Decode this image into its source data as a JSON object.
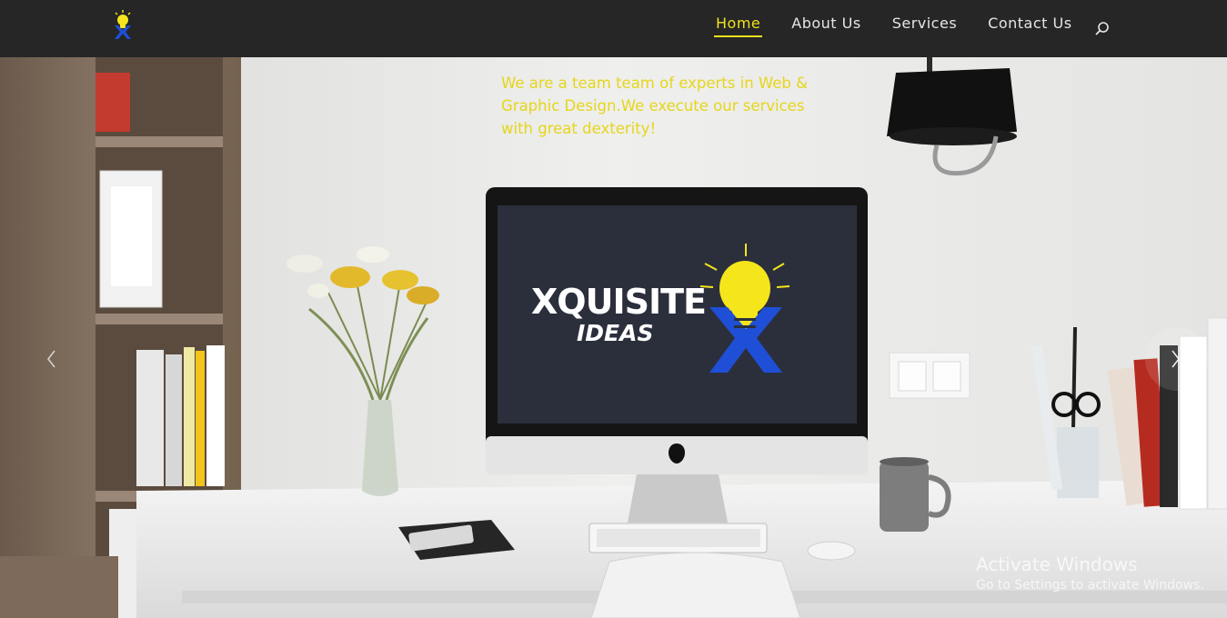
{
  "header": {
    "logo_icon": "lightbulb-x-logo-icon",
    "nav": [
      {
        "label": "Home",
        "active": true
      },
      {
        "label": "About Us",
        "active": false
      },
      {
        "label": "Services",
        "active": false
      },
      {
        "label": "Contact Us",
        "active": false
      }
    ],
    "search_icon": "search-icon"
  },
  "hero": {
    "tagline": "We are a team team of experts in Web & Graphic Design.We execute our services with great dexterity!",
    "brand_line1": "XQUISITE",
    "brand_line2": "IDEAS",
    "prev_icon": "chevron-left-icon",
    "next_icon": "chevron-right-icon"
  },
  "watermark": {
    "title": "Activate Windows",
    "subtitle": "Go to Settings to activate Windows."
  },
  "colors": {
    "accent": "#f0e21e",
    "header_bg": "#262626",
    "logo_blue": "#1f4fd6"
  }
}
